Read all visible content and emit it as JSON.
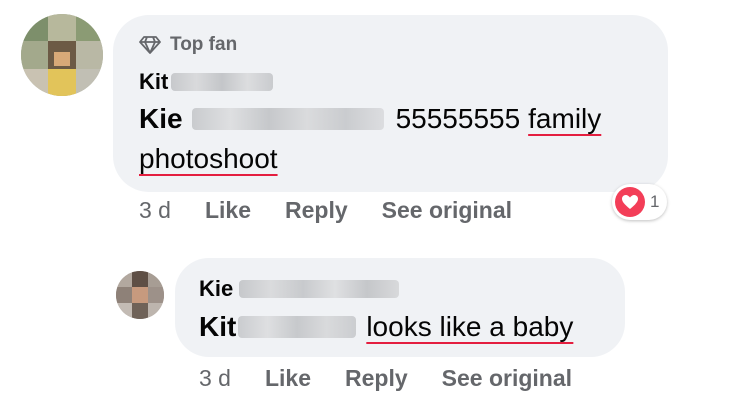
{
  "comment": {
    "badge_label": "Top fan",
    "author_visible": "Kit",
    "text_name": "Kie",
    "text_number": "55555555",
    "text_words_line1": "family",
    "text_words_line2": "photoshoot",
    "time": "3 d",
    "like_label": "Like",
    "reply_label": "Reply",
    "see_original_label": "See original",
    "reaction_count": "1"
  },
  "reply": {
    "author_visible": "Kie",
    "text_name": "Kit",
    "text_words": "looks like a baby",
    "time": "3 d",
    "like_label": "Like",
    "reply_label": "Reply",
    "see_original_label": "See original"
  },
  "colors": {
    "bubble": "#f0f2f5",
    "secondary_text": "#65676b",
    "spellcheck_underline": "#e41e3f",
    "love_reaction": "#f33e58"
  }
}
